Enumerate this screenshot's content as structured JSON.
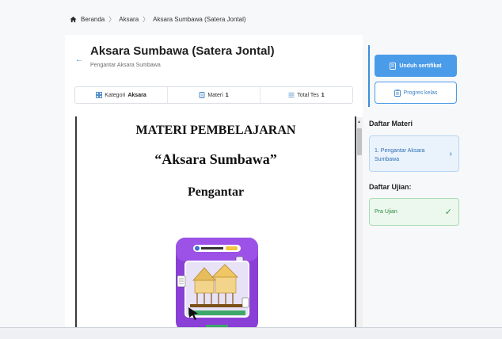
{
  "breadcrumb": {
    "items": [
      "Beranda",
      "Aksara",
      "Aksara Sumbawa (Satera Jontal)"
    ],
    "home_icon": "home-icon",
    "separator": "〉"
  },
  "header": {
    "title": "Aksara Sumbawa (Satera Jontal)",
    "subtitle": "Pengantar Aksara Sumbawa",
    "back_icon": "arrow-left-icon"
  },
  "stats": {
    "kategori_label": "Kategori",
    "kategori_value": "Aksara",
    "materi_label": "Materi",
    "materi_value": "1",
    "tes_label": "Total Tes",
    "tes_value": "1"
  },
  "document": {
    "heading1": "MATERI PEMBELAJARAN",
    "heading2": "“Aksara Sumbawa”",
    "heading3": "Pengantar"
  },
  "actions": {
    "download_label": "Unduh sertifikat",
    "progress_label": "Progres kelas"
  },
  "sidebar": {
    "materi_title": "Daftar Materi",
    "materi_items": [
      "1. Pengantar Aksara Sumbawa"
    ],
    "ujian_title": "Daftar Ujian:",
    "ujian_items": [
      "Pra Ujian"
    ]
  },
  "colors": {
    "accent": "#4a9be8",
    "materi_bg": "#eaf3fc",
    "ujian_bg": "#ecf8ee",
    "ujian_check": "#2f9a4a"
  }
}
